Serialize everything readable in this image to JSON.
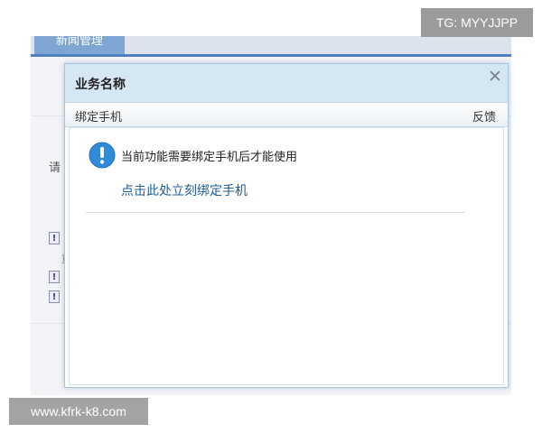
{
  "background": {
    "tab_label": "新闻管理",
    "prompt_text": "请",
    "warn_glyph": "!",
    "side_mark": "重"
  },
  "dialog": {
    "title": "业务名称",
    "close_glyph": "✕",
    "sub_label": "绑定手机",
    "feedback_label": "反馈",
    "notice": "当前功能需要绑定手机后才能使用",
    "link_text": "点击此处立刻绑定手机",
    "icon": "info-icon"
  },
  "watermarks": {
    "top": "TG: MYYJJPP",
    "bottom": "www.kfrk-k8.com"
  },
  "colors": {
    "header_bg": "#d6e7f4",
    "link": "#1f5d96",
    "icon_blue": "#2f8ad8",
    "tab": "#7fa6d3"
  }
}
